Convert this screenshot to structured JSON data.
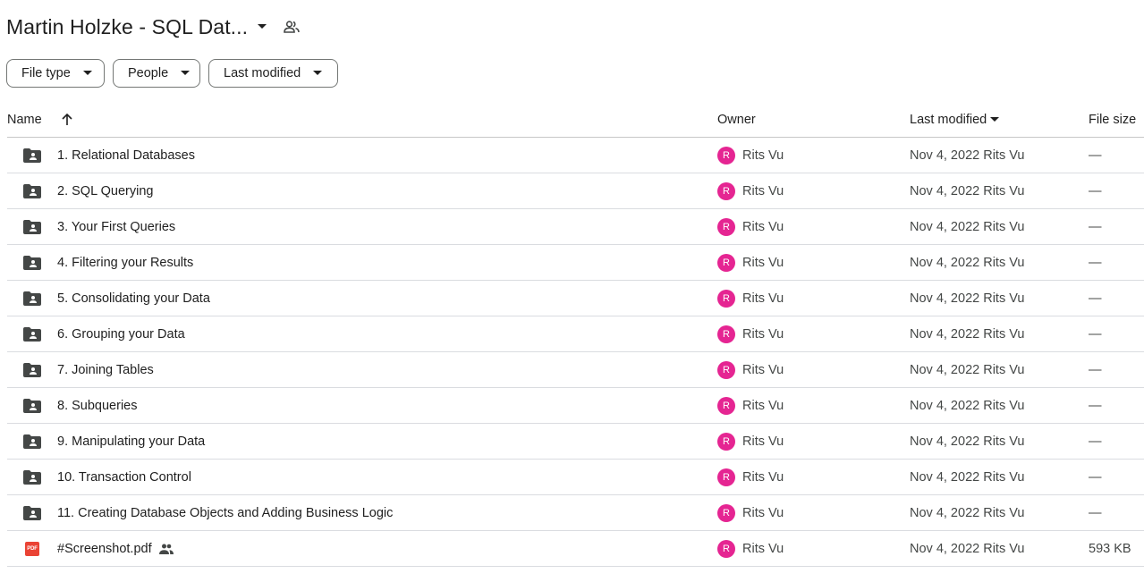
{
  "folder": {
    "title": "Martin Holzke - SQL Dat...",
    "caret_icon": "arrow-drop-down-icon",
    "shared_icon": "people-icon"
  },
  "filters": [
    {
      "label": "File type"
    },
    {
      "label": "People"
    },
    {
      "label": "Last modified"
    }
  ],
  "columns": {
    "name": "Name",
    "owner": "Owner",
    "last_modified": "Last modified",
    "file_size": "File size",
    "name_sort_icon": "arrow-up-icon",
    "modified_sort_icon": "arrow-drop-down-icon"
  },
  "rows": [
    {
      "name": "1. Relational Databases",
      "owner_initial": "R",
      "owner": "Rits Vu",
      "modified": "Nov 4, 2022 Rits Vu",
      "size": "—",
      "icon": "shared-folder-icon",
      "shared": false
    },
    {
      "name": "2. SQL Querying",
      "owner_initial": "R",
      "owner": "Rits Vu",
      "modified": "Nov 4, 2022 Rits Vu",
      "size": "—",
      "icon": "shared-folder-icon",
      "shared": false
    },
    {
      "name": "3. Your First Queries",
      "owner_initial": "R",
      "owner": "Rits Vu",
      "modified": "Nov 4, 2022 Rits Vu",
      "size": "—",
      "icon": "shared-folder-icon",
      "shared": false
    },
    {
      "name": "4. Filtering your Results",
      "owner_initial": "R",
      "owner": "Rits Vu",
      "modified": "Nov 4, 2022 Rits Vu",
      "size": "—",
      "icon": "shared-folder-icon",
      "shared": false
    },
    {
      "name": "5. Consolidating your Data",
      "owner_initial": "R",
      "owner": "Rits Vu",
      "modified": "Nov 4, 2022 Rits Vu",
      "size": "—",
      "icon": "shared-folder-icon",
      "shared": false
    },
    {
      "name": "6. Grouping your Data",
      "owner_initial": "R",
      "owner": "Rits Vu",
      "modified": "Nov 4, 2022 Rits Vu",
      "size": "—",
      "icon": "shared-folder-icon",
      "shared": false
    },
    {
      "name": "7. Joining Tables",
      "owner_initial": "R",
      "owner": "Rits Vu",
      "modified": "Nov 4, 2022 Rits Vu",
      "size": "—",
      "icon": "shared-folder-icon",
      "shared": false
    },
    {
      "name": "8. Subqueries",
      "owner_initial": "R",
      "owner": "Rits Vu",
      "modified": "Nov 4, 2022 Rits Vu",
      "size": "—",
      "icon": "shared-folder-icon",
      "shared": false
    },
    {
      "name": "9. Manipulating your Data",
      "owner_initial": "R",
      "owner": "Rits Vu",
      "modified": "Nov 4, 2022 Rits Vu",
      "size": "—",
      "icon": "shared-folder-icon",
      "shared": false
    },
    {
      "name": "10. Transaction Control",
      "owner_initial": "R",
      "owner": "Rits Vu",
      "modified": "Nov 4, 2022 Rits Vu",
      "size": "—",
      "icon": "shared-folder-icon",
      "shared": false
    },
    {
      "name": "11. Creating Database Objects and Adding Business Logic",
      "owner_initial": "R",
      "owner": "Rits Vu",
      "modified": "Nov 4, 2022 Rits Vu",
      "size": "—",
      "icon": "shared-folder-icon",
      "shared": false
    },
    {
      "name": "#Screenshot.pdf",
      "owner_initial": "R",
      "owner": "Rits Vu",
      "modified": "Nov 4, 2022 Rits Vu",
      "size": "593 KB",
      "icon": "pdf-icon",
      "icon_text": "PDF",
      "shared": true
    }
  ],
  "colors": {
    "avatar": "#e52592",
    "pdf": "#ea4335",
    "folder": "#444746"
  }
}
